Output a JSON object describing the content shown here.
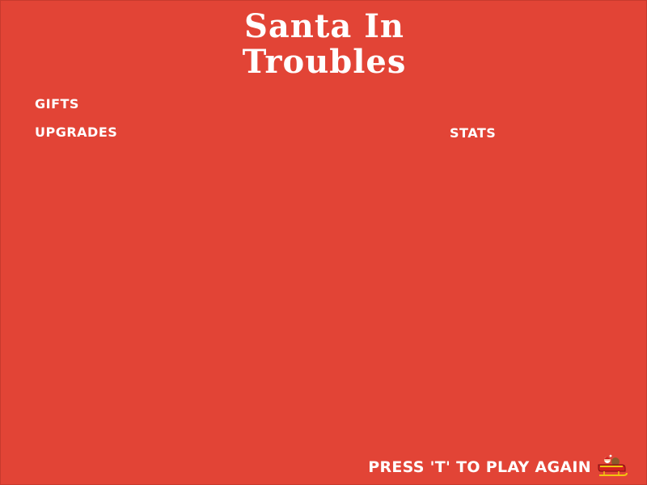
{
  "game": {
    "title_line1": "Santa In",
    "title_line2": "Troubles"
  },
  "menu": {
    "gifts_label": "Gifts",
    "upgrades_label": "Upgrades",
    "stats_label": "Stats"
  },
  "footer": {
    "prompt": "Press 'T' to play again"
  },
  "icons": {
    "sleigh": "santa-sleigh-icon"
  },
  "colors": {
    "background": "#e24436",
    "text": "#ffffff"
  }
}
